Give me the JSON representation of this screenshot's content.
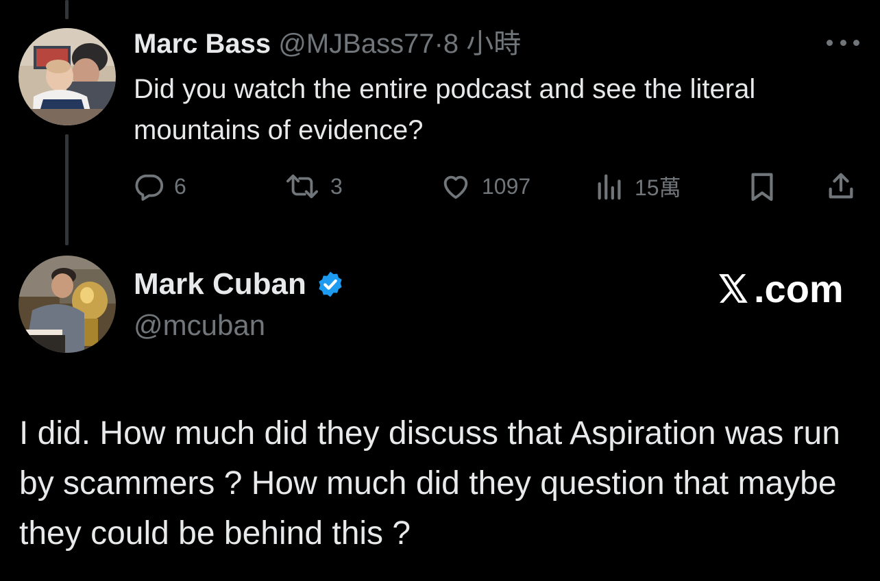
{
  "reply": {
    "author_name": "Marc Bass",
    "author_handle": "@MJBass77",
    "separator": "·",
    "timestamp": "8 小時",
    "text": "Did you watch the entire podcast and see the literal mountains of evidence?",
    "actions": {
      "replies": "6",
      "retweets": "3",
      "likes": "1097",
      "views": "15萬"
    }
  },
  "tweet": {
    "author_name": "Mark Cuban",
    "author_handle": "@mcuban",
    "verified": true,
    "text": "I did.  How much did they discuss that Aspiration was run by scammers ? How much did they question that maybe they could be behind this ?"
  },
  "watermark": {
    "text": ".com"
  },
  "icons": {
    "more": "more-icon",
    "reply": "reply-icon",
    "retweet": "retweet-icon",
    "like": "heart-icon",
    "views": "views-icon",
    "bookmark": "bookmark-icon",
    "share": "share-icon",
    "verified": "verified-badge-icon",
    "logo": "x-logo-icon"
  },
  "colors": {
    "background": "#000000",
    "text": "#e7e9ea",
    "muted": "#71767b",
    "verified": "#1d9bf0"
  }
}
